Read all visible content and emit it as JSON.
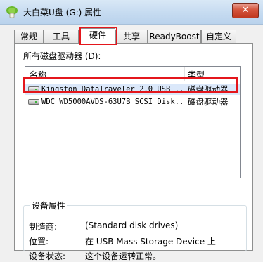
{
  "window": {
    "title": "大白菜U盘 (G:) 属性",
    "close_glyph": "✕"
  },
  "tabs": [
    {
      "label": "常规"
    },
    {
      "label": "工具"
    },
    {
      "label": "硬件",
      "active": true
    },
    {
      "label": "共享"
    },
    {
      "label": "ReadyBoost"
    },
    {
      "label": "自定义"
    }
  ],
  "hardware": {
    "section_label": "所有磁盘驱动器 (D):",
    "columns": {
      "name": "名称",
      "type": "类型"
    },
    "rows": [
      {
        "name": "Kingston DataTraveler 2.0 USB ...",
        "type": "磁盘驱动器",
        "icon": "usb-drive-icon",
        "selected": true
      },
      {
        "name": "WDC WD5000AVDS-63U7B SCSI Disk...",
        "type": "磁盘驱动器",
        "icon": "hard-disk-icon",
        "selected": false
      }
    ],
    "properties": {
      "title": "设备属性",
      "manufacturer_label": "制造商:",
      "manufacturer_value": "(Standard disk drives)",
      "location_label": "位置:",
      "location_value": "在 USB Mass Storage Device 上",
      "status_label": "设备状态:",
      "status_value": "这个设备运转正常。"
    }
  },
  "colors": {
    "highlight_border": "#e4161c",
    "selection": "#dbe8fa",
    "close_button": "#c0381f"
  }
}
